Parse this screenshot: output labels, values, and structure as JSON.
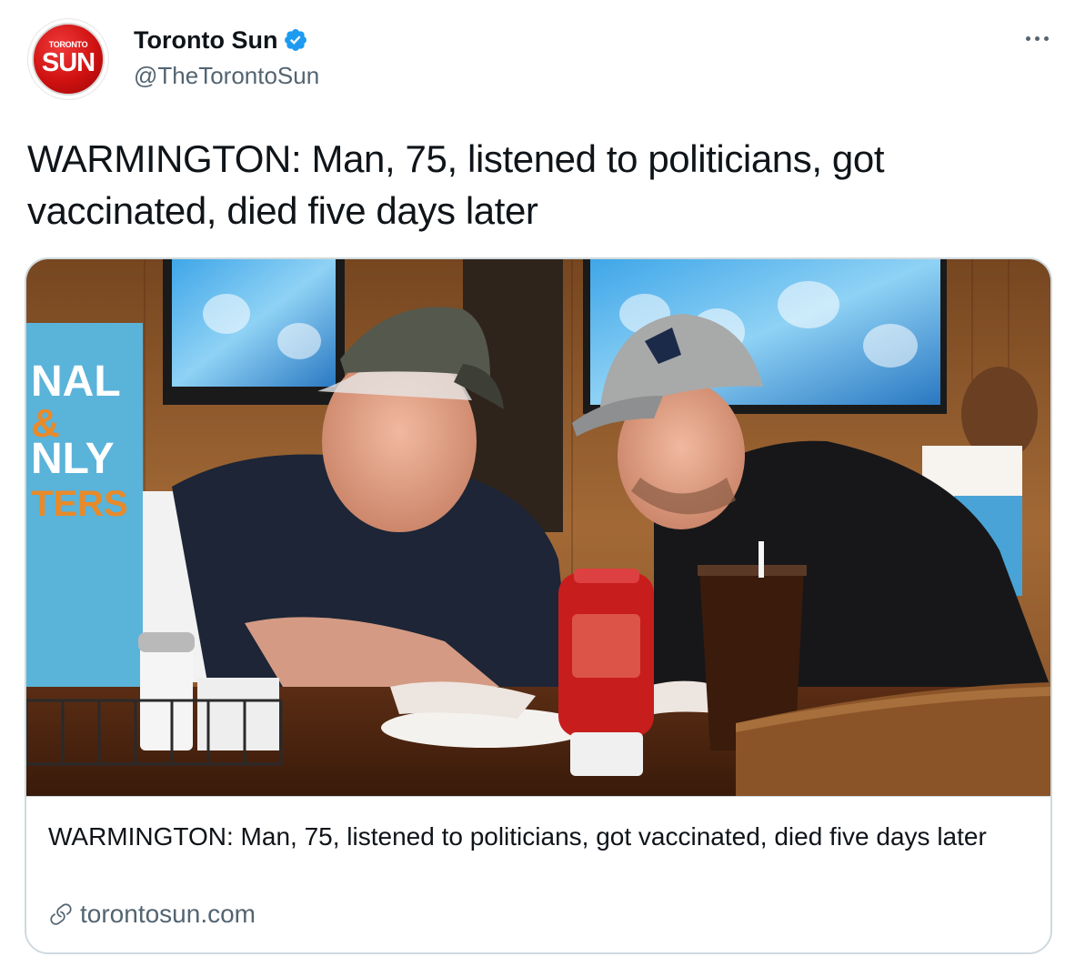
{
  "account": {
    "avatar_label_top": "TORONTO",
    "avatar_label_main": "SUN",
    "display_name": "Toronto Sun",
    "handle": "@TheTorontoSun",
    "verified": true,
    "verified_icon": "verified-badge-icon"
  },
  "tweet": {
    "text": "WARMINGTON: Man, 75, listened to politicians, got vaccinated, died five days later"
  },
  "card": {
    "title": "WARMINGTON: Man, 75, listened to politicians, got vaccinated, died five days later",
    "domain": "torontosun.com",
    "link_icon": "link-icon",
    "image_sign_text": [
      "NAL",
      "&",
      "NLY",
      "TERS"
    ]
  },
  "menu": {
    "icon": "more-options-icon"
  },
  "colors": {
    "verified_blue": "#1d9bf0",
    "text_primary": "#0f1419",
    "text_secondary": "#536471",
    "border": "#cfd9de",
    "brand_red": "#cf1111"
  }
}
